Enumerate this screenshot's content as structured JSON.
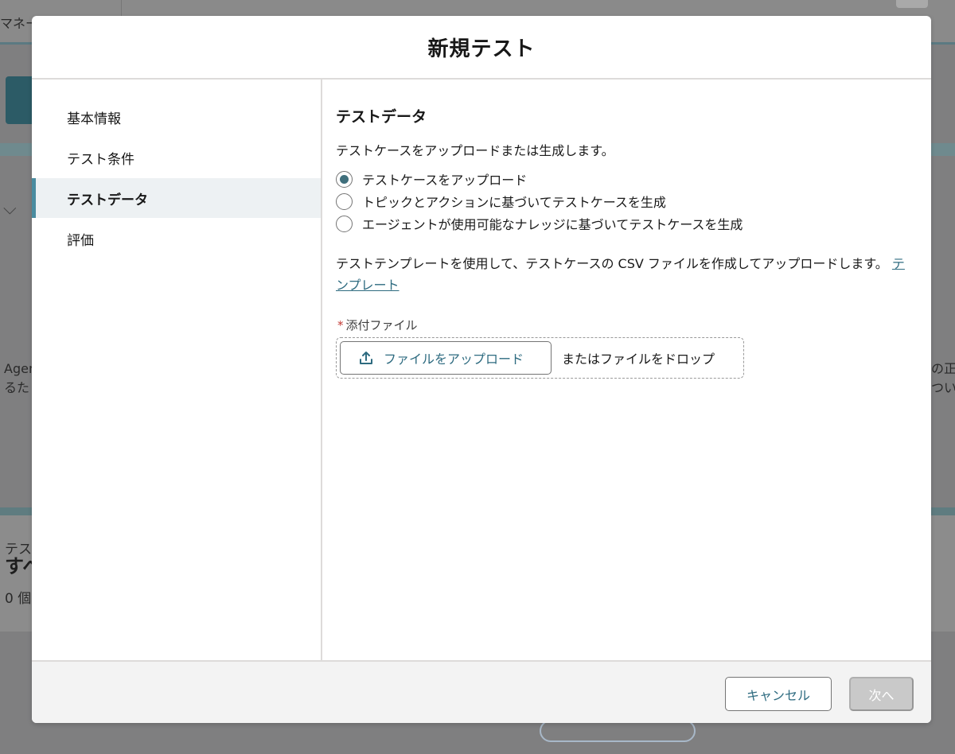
{
  "background": {
    "tab_label": "マネージ",
    "left_text_line1": "Agen",
    "left_text_line2": "るた",
    "right_text_line1": "の正",
    "right_text_line2": "つい",
    "bottom_small": "テス",
    "bottom_bold": "すべ",
    "bottom_count": "0 個"
  },
  "modal": {
    "title": "新規テスト",
    "nav": {
      "items": [
        {
          "label": "基本情報",
          "active": false
        },
        {
          "label": "テスト条件",
          "active": false
        },
        {
          "label": "テストデータ",
          "active": true
        },
        {
          "label": "評価",
          "active": false
        }
      ]
    },
    "content": {
      "section_title": "テストデータ",
      "description": "テストケースをアップロードまたは生成します。",
      "radio_options": [
        {
          "label": "テストケースをアップロード",
          "checked": true
        },
        {
          "label": "トピックとアクションに基づいてテストケースを生成",
          "checked": false
        },
        {
          "label": "エージェントが使用可能なナレッジに基づいてテストケースを生成",
          "checked": false
        }
      ],
      "help_text": "テストテンプレートを使用して、テストケースの CSV ファイルを作成してアップロードします。",
      "template_link": "テンプレート",
      "file_field": {
        "required_marker": "*",
        "label": "添付ファイル",
        "upload_button": "ファイルをアップロード",
        "drop_text": "またはファイルをドロップ"
      }
    },
    "footer": {
      "cancel_label": "キャンセル",
      "next_label": "次へ"
    }
  },
  "colors": {
    "accent": "#2e6b80",
    "nav_active_bar": "#4a8ca0",
    "required": "#c23934",
    "disabled_button": "#c9c9c9",
    "overlay": "#7f7f80"
  },
  "icons": [
    "upload-icon",
    "chevron-down-icon"
  ]
}
